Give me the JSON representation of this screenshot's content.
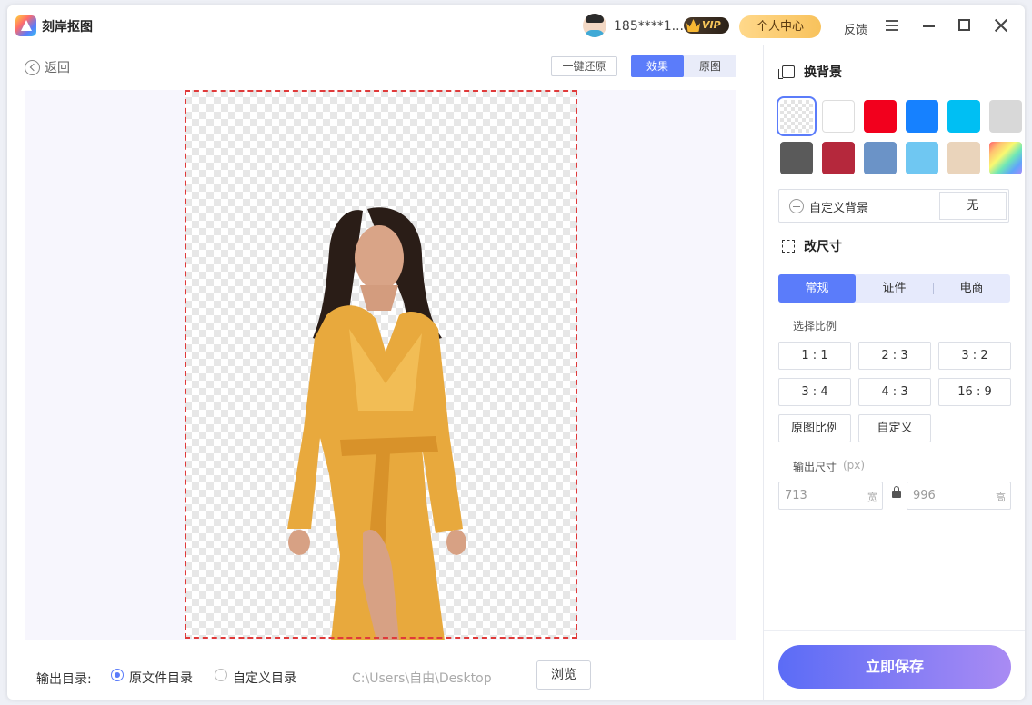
{
  "app": {
    "title": "刻岸抠图"
  },
  "header": {
    "user_name": "185****1...",
    "vip_label": "VIP",
    "personal_center": "个人中心",
    "feedback": "反馈"
  },
  "editor": {
    "back_label": "返回",
    "restore_label": "一键还原",
    "view_toggle": {
      "effect": "效果",
      "original": "原图",
      "active": "effect"
    }
  },
  "output": {
    "label": "输出目录:",
    "options": [
      "原文件目录",
      "自定义目录"
    ],
    "selected": "原文件目录",
    "path": "C:\\Users\\自由\\Desktop",
    "browse_label": "浏览"
  },
  "background": {
    "title": "换背景",
    "swatches": [
      {
        "name": "transparent",
        "color": "transparent",
        "selected": true
      },
      {
        "name": "white",
        "color": "#ffffff"
      },
      {
        "name": "red",
        "color": "#f2001d"
      },
      {
        "name": "blue",
        "color": "#1681ff"
      },
      {
        "name": "cyan",
        "color": "#00bff3"
      },
      {
        "name": "light-gray",
        "color": "#d8d8d8"
      },
      {
        "name": "dark-gray",
        "color": "#5a5a5a"
      },
      {
        "name": "crimson",
        "color": "#b5283c"
      },
      {
        "name": "steel-blue",
        "color": "#6b93c7"
      },
      {
        "name": "sky-blue",
        "color": "#6fc7f2"
      },
      {
        "name": "beige",
        "color": "#ead4bb"
      },
      {
        "name": "rainbow",
        "color": "gradient"
      }
    ],
    "custom_label": "自定义背景",
    "custom_value": "无"
  },
  "resize": {
    "title": "改尺寸",
    "tabs": [
      "常规",
      "证件",
      "电商"
    ],
    "active_tab": "常规",
    "ratio_label": "选择比例",
    "ratios": [
      "1 : 1",
      "2 : 3",
      "3 : 2",
      "3 : 4",
      "4 : 3",
      "16 : 9"
    ],
    "extra_buttons": [
      "原图比例",
      "自定义"
    ],
    "output_size_label": "输出尺寸",
    "output_size_unit": "(px)",
    "width_value": "713",
    "width_unit": "宽",
    "height_value": "996",
    "height_unit": "高"
  },
  "save_label": "立即保存",
  "colors": {
    "accent": "#5b7cfa",
    "crop_border": "#e03a3a"
  }
}
